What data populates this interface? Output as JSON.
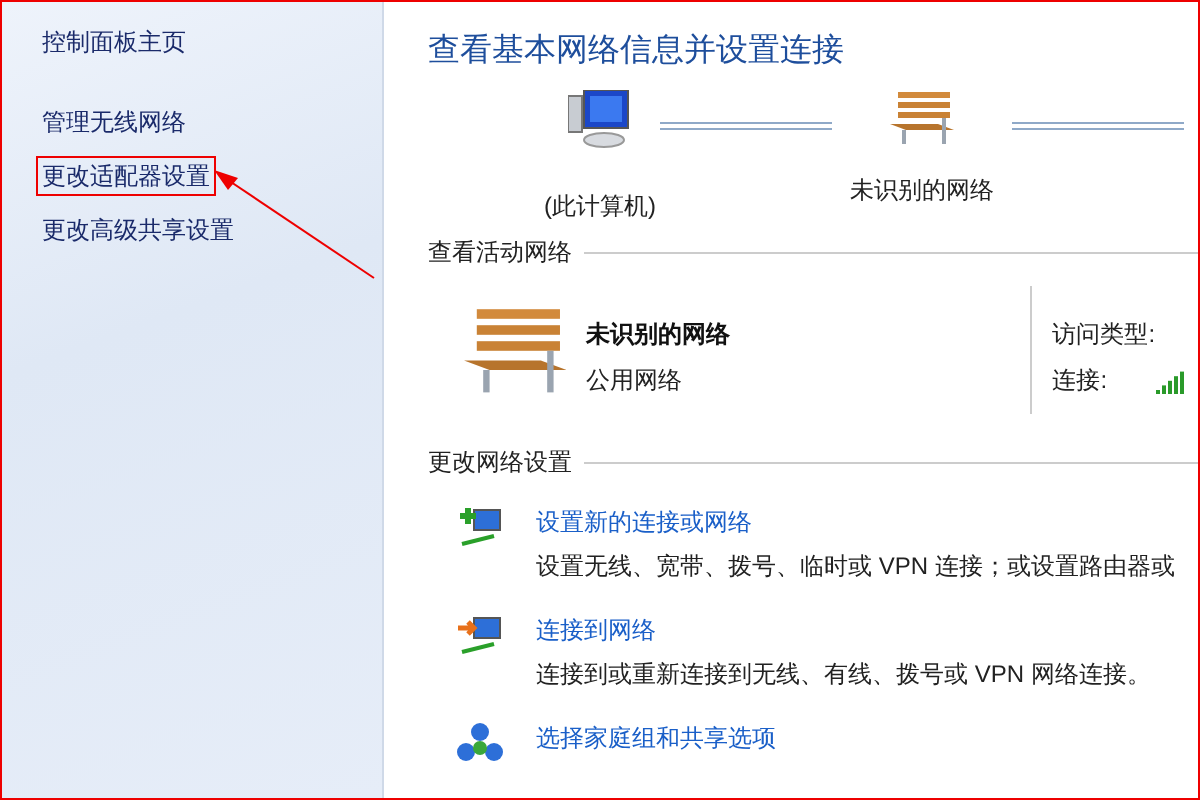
{
  "sidebar": {
    "items": [
      {
        "label": "控制面板主页",
        "highlighted": false
      },
      {
        "label": "管理无线网络",
        "highlighted": false
      },
      {
        "label": "更改适配器设置",
        "highlighted": true
      },
      {
        "label": "更改高级共享设置",
        "highlighted": false
      }
    ]
  },
  "main": {
    "title": "查看基本网络信息并设置连接",
    "network_map": [
      {
        "kind": "computer",
        "label": "(此计算机)"
      },
      {
        "kind": "network",
        "label": "未识别的网络"
      }
    ],
    "active_section": {
      "heading": "查看活动网络",
      "network_name": "未识别的网络",
      "network_type": "公用网络",
      "access_type_label": "访问类型:",
      "connection_label": "连接:"
    },
    "settings_section": {
      "heading": "更改网络设置",
      "tasks": [
        {
          "kind": "new-connection",
          "link": "设置新的连接或网络",
          "description": "设置无线、宽带、拨号、临时或 VPN 连接；或设置路由器或"
        },
        {
          "kind": "connect",
          "link": "连接到网络",
          "description": "连接到或重新连接到无线、有线、拨号或 VPN 网络连接。"
        },
        {
          "kind": "homegroup",
          "link": "选择家庭组和共享选项"
        }
      ]
    }
  }
}
